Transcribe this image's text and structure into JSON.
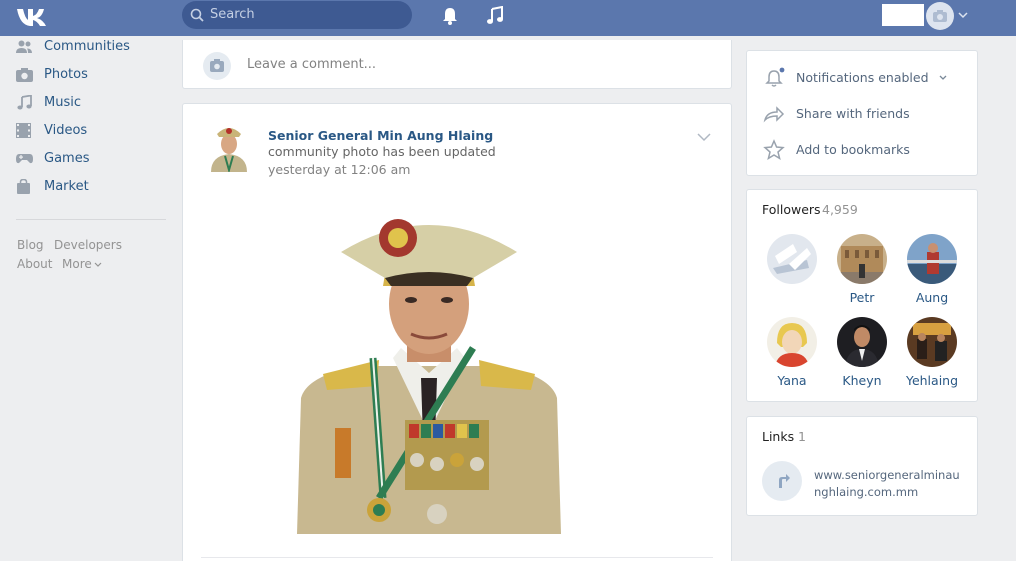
{
  "header": {
    "search_placeholder": "Search"
  },
  "nav": {
    "items": [
      {
        "label": "Communities",
        "icon": "communities-icon"
      },
      {
        "label": "Photos",
        "icon": "camera-icon"
      },
      {
        "label": "Music",
        "icon": "music-icon"
      },
      {
        "label": "Videos",
        "icon": "film-icon"
      },
      {
        "label": "Games",
        "icon": "gamepad-icon"
      },
      {
        "label": "Market",
        "icon": "bag-icon"
      }
    ],
    "footer": [
      "Blog",
      "Developers",
      "About",
      "More"
    ]
  },
  "comment": {
    "placeholder": "Leave a comment..."
  },
  "post": {
    "author": "Senior General Min Aung Hlaing",
    "subtitle": "community photo has been updated",
    "time": "yesterday at 12:06 am"
  },
  "actions": {
    "notifications": "Notifications enabled",
    "share": "Share with friends",
    "bookmark": "Add to bookmarks"
  },
  "followers": {
    "title": "Followers",
    "count": "4,959",
    "people": [
      "",
      "Petr",
      "Aung",
      "Yana",
      "Kheyn",
      "Yehlaing"
    ]
  },
  "links": {
    "title": "Links",
    "count": "1",
    "url": "www.seniorgeneralminaunghlaing.com.mm"
  },
  "colors": {
    "header": "#5b77ad",
    "search": "#3e5a92",
    "link": "#2a5885",
    "background": "#edeef0"
  }
}
